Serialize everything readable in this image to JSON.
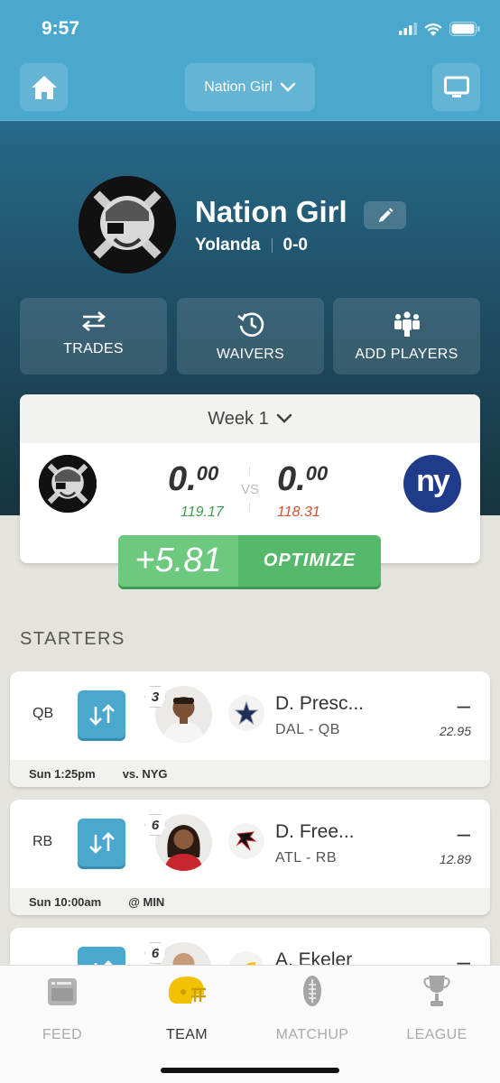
{
  "status_bar": {
    "time": "9:57"
  },
  "top_nav": {
    "team_selector": "Nation Girl"
  },
  "team": {
    "name": "Nation Girl",
    "owner": "Yolanda",
    "record": "0-0"
  },
  "actions": [
    {
      "label": "TRADES",
      "icon": "swap-arrows-icon"
    },
    {
      "label": "WAIVERS",
      "icon": "clock-history-icon"
    },
    {
      "label": "ADD PLAYERS",
      "icon": "group-icon"
    }
  ],
  "matchup": {
    "week": "Week 1",
    "vs": "VS",
    "home": {
      "score_main": "0.",
      "score_dec": "00",
      "projected": "119.17"
    },
    "away": {
      "score_main": "0.",
      "score_dec": "00",
      "projected": "118.31",
      "logo_text": "ny"
    }
  },
  "optimize": {
    "delta": "+5.81",
    "label": "OPTIMIZE"
  },
  "starters_title": "STARTERS",
  "starters": [
    {
      "pos": "QB",
      "rank": "3",
      "name": "D. Presc...",
      "team_pos": "DAL - QB",
      "score": "–",
      "projected": "22.95",
      "game_time": "Sun 1:25pm",
      "opponent": "vs. NYG"
    },
    {
      "pos": "RB",
      "rank": "6",
      "name": "D. Free...",
      "team_pos": "ATL - RB",
      "score": "–",
      "projected": "12.89",
      "game_time": "Sun 10:00am",
      "opponent": "@ MIN"
    },
    {
      "pos": "",
      "rank": "6",
      "name": "A. Ekeler",
      "team_pos": "",
      "score": "–",
      "projected": "",
      "game_time": "",
      "opponent": ""
    }
  ],
  "tabs": [
    {
      "label": "FEED",
      "icon": "feed-icon"
    },
    {
      "label": "TEAM",
      "icon": "helmet-icon"
    },
    {
      "label": "MATCHUP",
      "icon": "football-icon"
    },
    {
      "label": "LEAGUE",
      "icon": "trophy-icon"
    }
  ],
  "colors": {
    "primary": "#4aa8cf",
    "optimize_green": "#56b86a",
    "projected_up": "#3e9b4f",
    "projected_down": "#d35230",
    "giants_blue": "#1f3b8a"
  }
}
